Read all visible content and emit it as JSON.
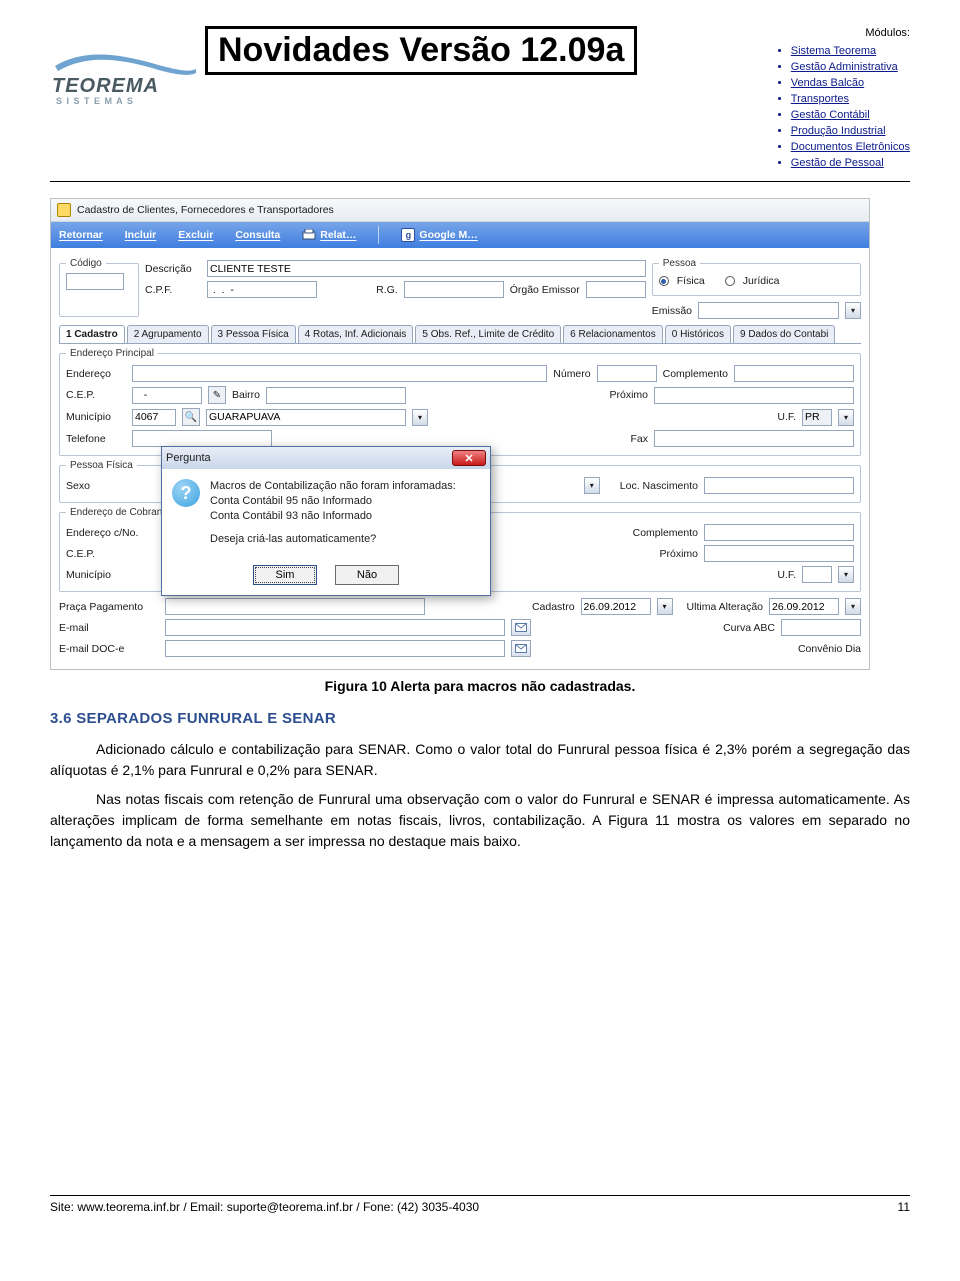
{
  "header": {
    "logo_primary": "TEOREMA",
    "logo_secondary": "S I S T E M A S",
    "title": "Novidades Versão 12.09a",
    "modules_label": "Módulos:",
    "modules": [
      "Sistema Teorema",
      "Gestão Administrativa",
      "Vendas Balcão",
      "Transportes",
      "Gestão Contábil",
      "Produção Industrial",
      "Documentos Eletrônicos",
      "Gestão de Pessoal"
    ]
  },
  "screenshot": {
    "window_title": "Cadastro de Clientes, Fornecedores e Transportadores",
    "toolbar": {
      "retornar": "Retornar",
      "incluir": "Incluir",
      "excluir": "Excluir",
      "consulta": "Consulta",
      "relat": "Relat…",
      "google": "Google M…"
    },
    "topfields": {
      "codigo_label": "Código",
      "descricao_label": "Descrição",
      "descricao_value": "CLIENTE TESTE",
      "cpf_label": "C.P.F.",
      "cpf_value": " .  .  -",
      "rg_label": "R.G.",
      "rg_value": "",
      "orgao_label": "Órgão Emissor",
      "orgao_value": "",
      "pessoa_legend": "Pessoa",
      "pessoa_fisica": "Física",
      "pessoa_juridica": "Jurídica",
      "emissao_label": "Emissão",
      "emissao_value": ""
    },
    "tabs": [
      "1 Cadastro",
      "2 Agrupamento",
      "3 Pessoa Física",
      "4 Rotas, Inf. Adicionais",
      "5 Obs. Ref., Limite de Crédito",
      "6 Relacionamentos",
      "0 Históricos",
      "9 Dados do Contabi"
    ],
    "endereco_principal": {
      "legend": "Endereço Principal",
      "endereco_label": "Endereço",
      "endereco_value": "",
      "numero_label": "Número",
      "numero_value": "",
      "complemento_label": "Complemento",
      "complemento_value": "",
      "cep_label": "C.E.P.",
      "cep_value": "   -",
      "bairro_label": "Bairro",
      "bairro_value": "",
      "proximo_label": "Próximo",
      "proximo_value": "",
      "municipio_label": "Município",
      "municipio_cod": "4067",
      "municipio_nome": "GUARAPUAVA",
      "uf_label": "U.F.",
      "uf_value": "PR",
      "telefone_label": "Telefone",
      "telefone_value": "",
      "fax_label": "Fax",
      "fax_value": ""
    },
    "pessoa_fisica": {
      "legend": "Pessoa Física",
      "sexo_label": "Sexo",
      "locnasc_label": "Loc. Nascimento",
      "locnasc_value": ""
    },
    "endereco_cobranca": {
      "legend": "Endereço de Cobran",
      "endereco_cno_label": "Endereço c/No.",
      "complemento_label": "Complemento",
      "complemento_value": "",
      "cep_label": "C.E.P.",
      "proximo_label": "Próximo",
      "proximo_value": "",
      "municipio_label": "Município",
      "uf_label": "U.F."
    },
    "footer_fields": {
      "praca_label": "Praça Pagamento",
      "email_label": "E-mail",
      "email_value": "",
      "email_doce_label": "E-mail DOC-e",
      "email_doce_value": "",
      "cadastro_label": "Cadastro",
      "cadastro_value": "26.09.2012",
      "ultalt_label": "Ultima Alteração",
      "ultalt_value": "26.09.2012",
      "curva_label": "Curva ABC",
      "convenio_label": "Convênio Dia"
    },
    "dialog": {
      "title": "Pergunta",
      "line1": "Macros de Contabilização não foram inforamadas:",
      "line2": "Conta Contábil 95 não Informado",
      "line3": "Conta Contábil 93 não Informado",
      "line4": "Deseja criá-las automaticamente?",
      "btn_sim": "Sim",
      "btn_nao": "Não"
    }
  },
  "figure_caption": "Figura 10 Alerta para macros não cadastradas.",
  "section": {
    "heading": "3.6 SEPARADOS FUNRURAL E SENAR",
    "para1": "Adicionado cálculo e contabilização para SENAR. Como o valor total do Funrural pessoa física é 2,3% porém a segregação das alíquotas é 2,1% para Funrural e 0,2% para SENAR.",
    "para2": "Nas notas fiscais com retenção de Funrural uma observação com o valor do Funrural e SENAR é impressa automaticamente. As alterações implicam de forma semelhante em notas fiscais, livros, contabilização. A Figura 11 mostra os valores em separado no lançamento da nota e a mensagem a ser impressa no destaque mais baixo."
  },
  "footer": {
    "text": "Site: www.teorema.inf.br / Email: suporte@teorema.inf.br / Fone: (42) 3035-4030",
    "page": "11"
  }
}
